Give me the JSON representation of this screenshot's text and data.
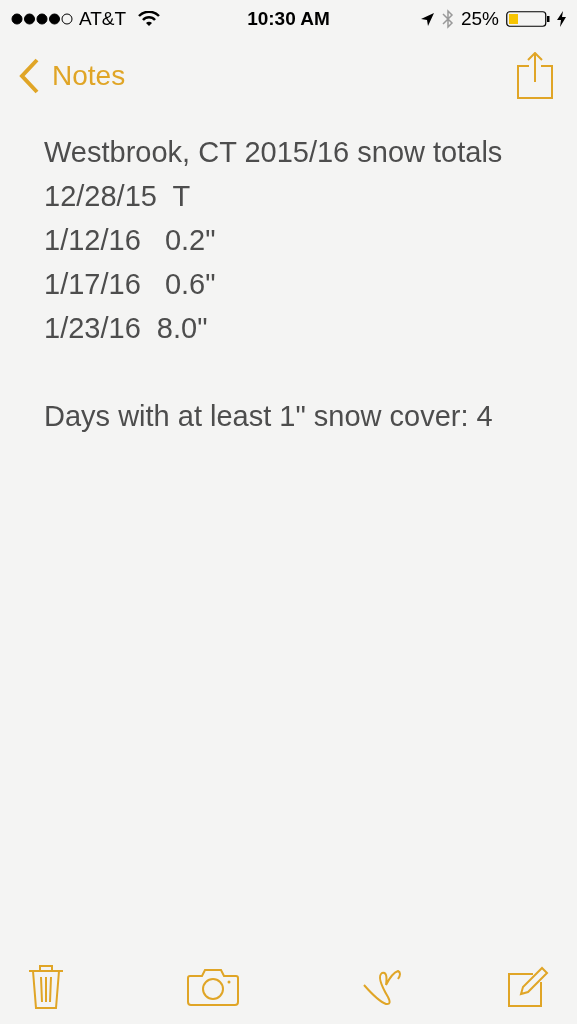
{
  "status_bar": {
    "carrier": "AT&T",
    "time": "10:30 AM",
    "battery_percent": "25%"
  },
  "nav": {
    "back_label": "Notes"
  },
  "note": {
    "paragraphs": [
      [
        "Westbrook, CT 2015/16 snow totals",
        "12/28/15  T",
        "1/12/16   0.2\"",
        "1/17/16   0.6\"",
        "1/23/16  8.0\""
      ],
      [
        "Days with at least 1\" snow cover: 4"
      ]
    ]
  }
}
